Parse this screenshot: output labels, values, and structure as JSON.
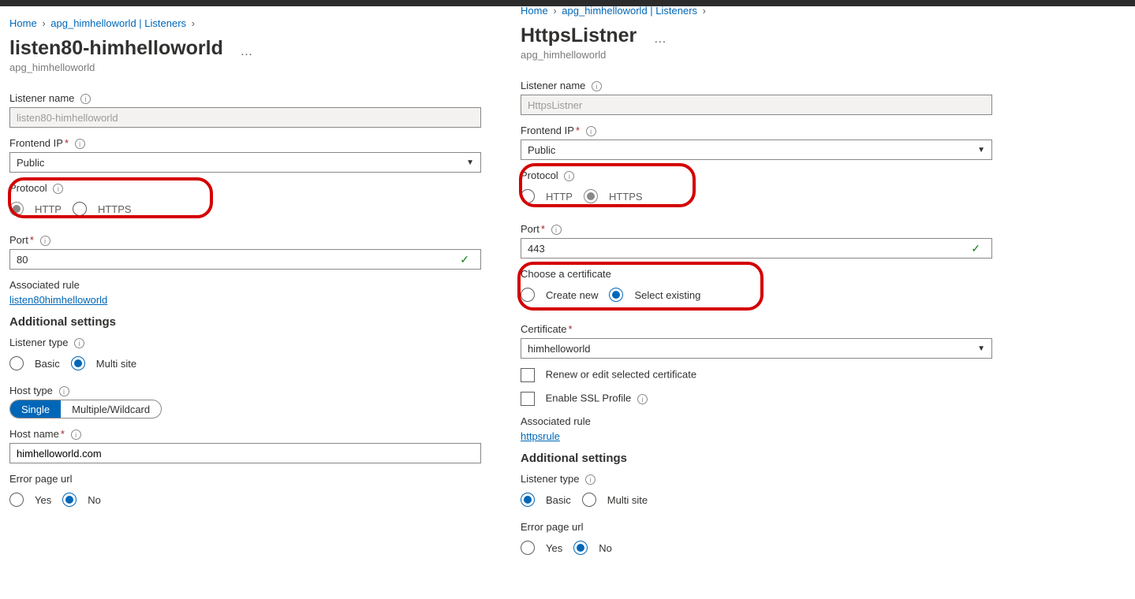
{
  "left": {
    "crumbs": [
      "Home",
      "apg_himhelloworld | Listeners"
    ],
    "title": "listen80-himhelloworld",
    "subtitle": "apg_himhelloworld",
    "listenerName_label": "Listener name",
    "listenerName_value": "listen80-himhelloworld",
    "frontend_label": "Frontend IP",
    "frontend_value": "Public",
    "protocol_label": "Protocol",
    "protocol_http": "HTTP",
    "protocol_https": "HTTPS",
    "port_label": "Port",
    "port_value": "80",
    "assocRule_label": "Associated rule",
    "assocRule_link": "listen80himhelloworld",
    "additional_h": "Additional settings",
    "listenerType_label": "Listener type",
    "listenerType_basic": "Basic",
    "listenerType_multi": "Multi site",
    "hostType_label": "Host type",
    "hostType_single": "Single",
    "hostType_multi": "Multiple/Wildcard",
    "hostName_label": "Host name",
    "hostName_value": "himhelloworld.com",
    "errorPage_label": "Error page url",
    "yes": "Yes",
    "no": "No"
  },
  "right": {
    "crumbs": [
      "Home",
      "apg_himhelloworld | Listeners"
    ],
    "title": "HttpsListner",
    "subtitle": "apg_himhelloworld",
    "listenerName_label": "Listener name",
    "listenerName_value": "HttpsListner",
    "frontend_label": "Frontend IP",
    "frontend_value": "Public",
    "protocol_label": "Protocol",
    "protocol_http": "HTTP",
    "protocol_https": "HTTPS",
    "port_label": "Port",
    "port_value": "443",
    "chooseCert_label": "Choose a certificate",
    "cert_create": "Create new",
    "cert_select": "Select existing",
    "cert_label": "Certificate",
    "cert_value": "himhelloworld",
    "renew_label": "Renew or edit selected certificate",
    "ssl_label": "Enable SSL Profile",
    "assocRule_label": "Associated rule",
    "assocRule_link": "httpsrule",
    "additional_h": "Additional settings",
    "listenerType_label": "Listener type",
    "listenerType_basic": "Basic",
    "listenerType_multi": "Multi site",
    "errorPage_label": "Error page url",
    "yes": "Yes",
    "no": "No"
  }
}
